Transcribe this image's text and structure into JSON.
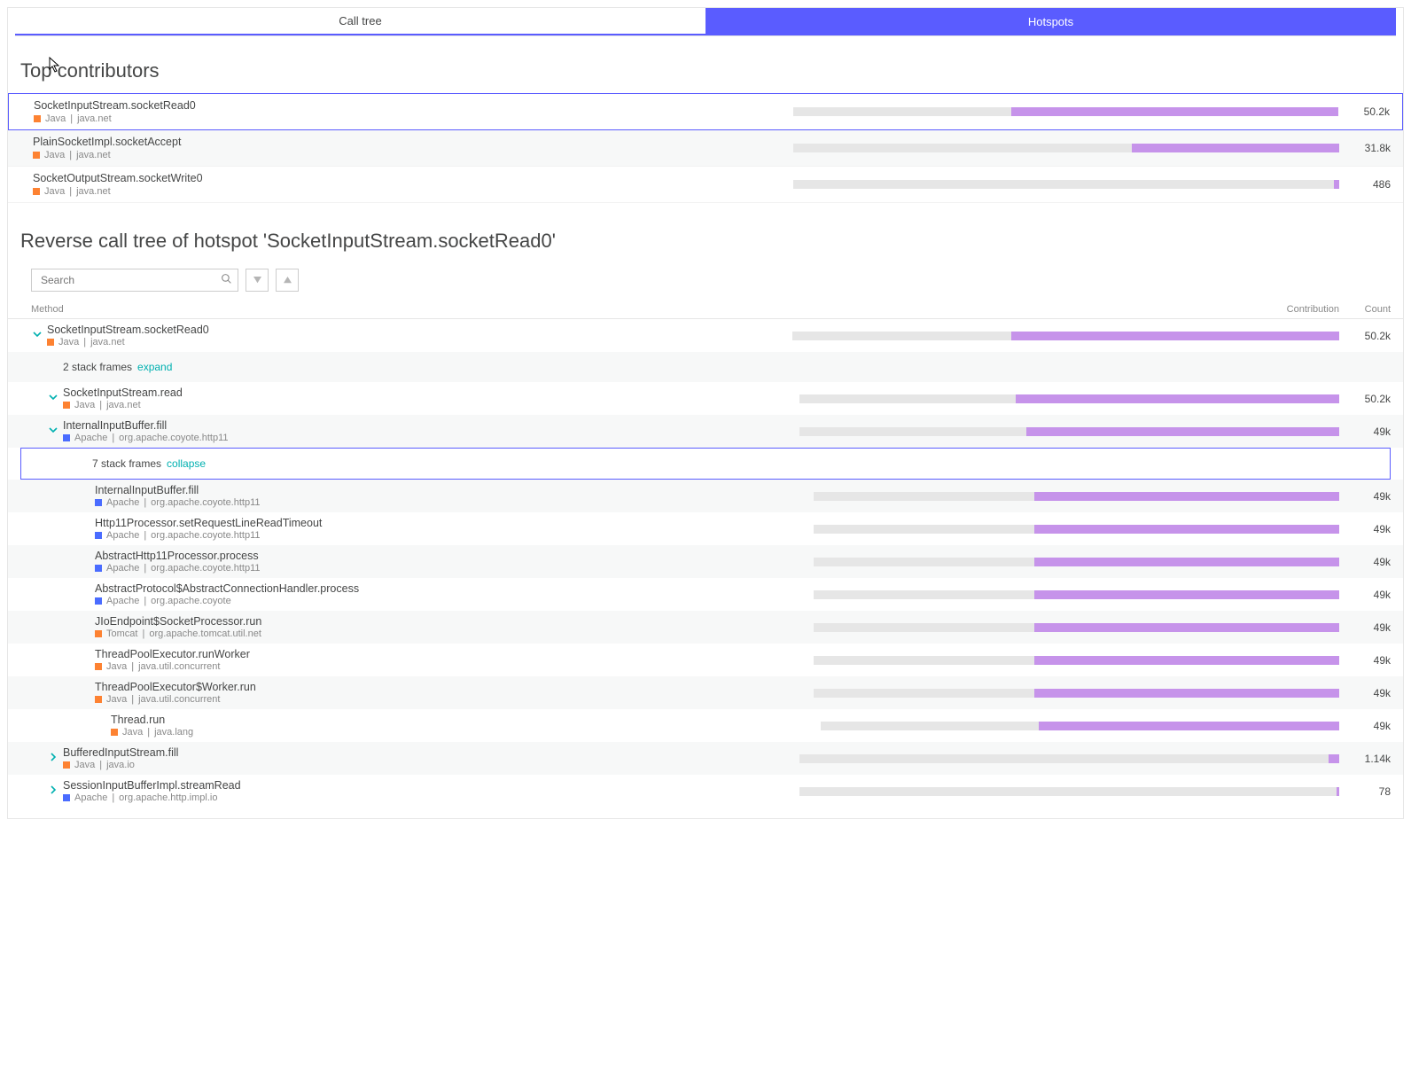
{
  "tabs": {
    "call_tree": "Call tree",
    "hotspots": "Hotspots"
  },
  "top_contributors": {
    "title": "Top contributors",
    "rows": [
      {
        "method": "SocketInputStream.socketRead0",
        "tech": "Java",
        "pkg": "java.net",
        "swatch": "orange",
        "count": "50.2k",
        "fillPct": 60
      },
      {
        "method": "PlainSocketImpl.socketAccept",
        "tech": "Java",
        "pkg": "java.net",
        "swatch": "orange",
        "count": "31.8k",
        "fillPct": 38
      },
      {
        "method": "SocketOutputStream.socketWrite0",
        "tech": "Java",
        "pkg": "java.net",
        "swatch": "orange",
        "count": "486",
        "fillPct": 1
      }
    ]
  },
  "rct": {
    "title": "Reverse call tree of hotspot 'SocketInputStream.socketRead0'",
    "search_placeholder": "Search",
    "headers": {
      "method": "Method",
      "contribution": "Contribution",
      "count": "Count"
    }
  },
  "tree": [
    {
      "type": "node",
      "indent": 0,
      "chev": "down",
      "method": "SocketInputStream.socketRead0",
      "tech": "Java",
      "pkg": "java.net",
      "swatch": "orange",
      "count": "50.2k",
      "fillPct": 60,
      "alt": false
    },
    {
      "type": "frames",
      "indent": 1,
      "frames_label": "2 stack frames",
      "action": "expand",
      "alt": true,
      "selected": false
    },
    {
      "type": "node",
      "indent": 1,
      "chev": "down",
      "method": "SocketInputStream.read",
      "tech": "Java",
      "pkg": "java.net",
      "swatch": "orange",
      "count": "50.2k",
      "fillPct": 60,
      "alt": false
    },
    {
      "type": "node",
      "indent": 1,
      "chev": "down",
      "method": "InternalInputBuffer.fill",
      "tech": "Apache",
      "pkg": "org.apache.coyote.http11",
      "swatch": "blue",
      "count": "49k",
      "fillPct": 58,
      "alt": true
    },
    {
      "type": "frames",
      "indent": 2,
      "frames_label": "7 stack frames",
      "action": "collapse",
      "alt": false,
      "selected": true
    },
    {
      "type": "node",
      "indent": 3,
      "chev": "none",
      "method": "InternalInputBuffer.fill",
      "tech": "Apache",
      "pkg": "org.apache.coyote.http11",
      "swatch": "blue",
      "count": "49k",
      "fillPct": 58,
      "alt": true
    },
    {
      "type": "node",
      "indent": 3,
      "chev": "none",
      "method": "Http11Processor.setRequestLineReadTimeout",
      "tech": "Apache",
      "pkg": "org.apache.coyote.http11",
      "swatch": "blue",
      "count": "49k",
      "fillPct": 58,
      "alt": false
    },
    {
      "type": "node",
      "indent": 3,
      "chev": "none",
      "method": "AbstractHttp11Processor.process",
      "tech": "Apache",
      "pkg": "org.apache.coyote.http11",
      "swatch": "blue",
      "count": "49k",
      "fillPct": 58,
      "alt": true
    },
    {
      "type": "node",
      "indent": 3,
      "chev": "none",
      "method": "AbstractProtocol$AbstractConnectionHandler.process",
      "tech": "Apache",
      "pkg": "org.apache.coyote",
      "swatch": "blue",
      "count": "49k",
      "fillPct": 58,
      "alt": false
    },
    {
      "type": "node",
      "indent": 3,
      "chev": "none",
      "method": "JIoEndpoint$SocketProcessor.run",
      "tech": "Tomcat",
      "pkg": "org.apache.tomcat.util.net",
      "swatch": "orange",
      "count": "49k",
      "fillPct": 58,
      "alt": true
    },
    {
      "type": "node",
      "indent": 3,
      "chev": "none",
      "method": "ThreadPoolExecutor.runWorker",
      "tech": "Java",
      "pkg": "java.util.concurrent",
      "swatch": "orange",
      "count": "49k",
      "fillPct": 58,
      "alt": false
    },
    {
      "type": "node",
      "indent": 3,
      "chev": "none",
      "method": "ThreadPoolExecutor$Worker.run",
      "tech": "Java",
      "pkg": "java.util.concurrent",
      "swatch": "orange",
      "count": "49k",
      "fillPct": 58,
      "alt": true
    },
    {
      "type": "node",
      "indent": 4,
      "chev": "none",
      "method": "Thread.run",
      "tech": "Java",
      "pkg": "java.lang",
      "swatch": "orange",
      "count": "49k",
      "fillPct": 58,
      "alt": false
    },
    {
      "type": "node",
      "indent": 1,
      "chev": "right",
      "method": "BufferedInputStream.fill",
      "tech": "Java",
      "pkg": "java.io",
      "swatch": "orange",
      "count": "1.14k",
      "fillPct": 2,
      "alt": true
    },
    {
      "type": "node",
      "indent": 1,
      "chev": "right",
      "method": "SessionInputBufferImpl.streamRead",
      "tech": "Apache",
      "pkg": "org.apache.http.impl.io",
      "swatch": "blue",
      "count": "78",
      "fillPct": 0.5,
      "alt": false
    }
  ]
}
